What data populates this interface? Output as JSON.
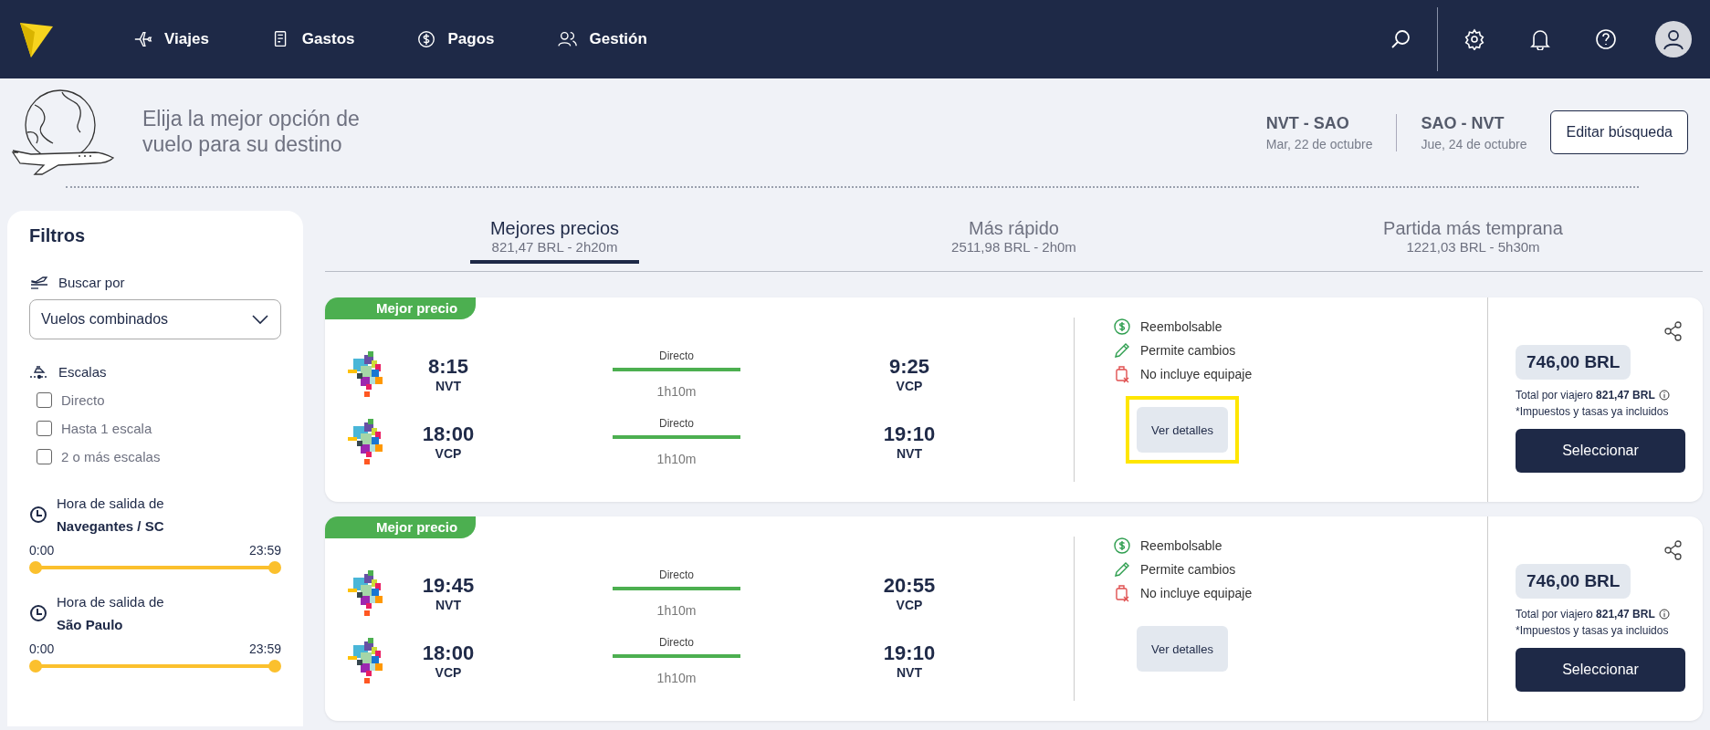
{
  "nav": {
    "items": [
      {
        "label": "Viajes"
      },
      {
        "label": "Gastos"
      },
      {
        "label": "Pagos"
      },
      {
        "label": "Gestión"
      }
    ]
  },
  "header": {
    "title": "Elija la mejor opción de vuelo para su destino",
    "legs": [
      {
        "route": "NVT - SAO",
        "date": "Mar, 22 de octubre"
      },
      {
        "route": "SAO - NVT",
        "date": "Jue, 24 de octubre"
      }
    ],
    "edit_button": "Editar búsqueda"
  },
  "filters": {
    "title": "Filtros",
    "search_by": {
      "label": "Buscar por",
      "value": "Vuelos combinados"
    },
    "stops": {
      "label": "Escalas",
      "options": [
        {
          "label": "Directo",
          "checked": false
        },
        {
          "label": "Hasta 1 escala",
          "checked": false
        },
        {
          "label": "2 o más escalas",
          "checked": false
        }
      ]
    },
    "time_filters": [
      {
        "label": "Hora de salida de",
        "place": "Navegantes / SC",
        "min": "0:00",
        "max": "23:59",
        "level": 1
      },
      {
        "label": "Hora de salida de",
        "place": "São Paulo",
        "min": "0:00",
        "max": "23:59",
        "level": 1
      }
    ]
  },
  "tabs": [
    {
      "label": "Mejores precios",
      "sub": "821,47 BRL - 2h20m",
      "selected": true
    },
    {
      "label": "Más rápido",
      "sub": "2511,98 BRL - 2h0m",
      "selected": false
    },
    {
      "label": "Partida más temprana",
      "sub": "1221,03 BRL - 5h30m",
      "selected": false
    }
  ],
  "results": [
    {
      "badge": "Mejor precio",
      "segments": [
        {
          "dep_time": "8:15",
          "dep_code": "NVT",
          "stop_label": "Directo",
          "duration": "1h10m",
          "arr_time": "9:25",
          "arr_code": "VCP"
        },
        {
          "dep_time": "18:00",
          "dep_code": "VCP",
          "stop_label": "Directo",
          "duration": "1h10m",
          "arr_time": "19:10",
          "arr_code": "NVT"
        }
      ],
      "conditions": [
        {
          "kind": "refund",
          "label": "Reembolsable"
        },
        {
          "kind": "changes",
          "label": "Permite cambios"
        },
        {
          "kind": "baggage",
          "label": "No incluye equipaje"
        }
      ],
      "details_button": "Ver detalles",
      "highlighted": true,
      "price": "746,00 BRL",
      "total_label": "Total por viajero",
      "total_value": "821,47 BRL",
      "taxes_note": "*Impuestos y tasas ya incluidos",
      "select_button": "Seleccionar"
    },
    {
      "badge": "Mejor precio",
      "segments": [
        {
          "dep_time": "19:45",
          "dep_code": "NVT",
          "stop_label": "Directo",
          "duration": "1h10m",
          "arr_time": "20:55",
          "arr_code": "VCP"
        },
        {
          "dep_time": "18:00",
          "dep_code": "VCP",
          "stop_label": "Directo",
          "duration": "1h10m",
          "arr_time": "19:10",
          "arr_code": "NVT"
        }
      ],
      "conditions": [
        {
          "kind": "refund",
          "label": "Reembolsable"
        },
        {
          "kind": "changes",
          "label": "Permite cambios"
        },
        {
          "kind": "baggage",
          "label": "No incluye equipaje"
        }
      ],
      "details_button": "Ver detalles",
      "highlighted": false,
      "price": "746,00 BRL",
      "total_label": "Total por viajero",
      "total_value": "821,47 BRL",
      "taxes_note": "*Impuestos y tasas ya incluidos",
      "select_button": "Seleccionar"
    }
  ]
}
